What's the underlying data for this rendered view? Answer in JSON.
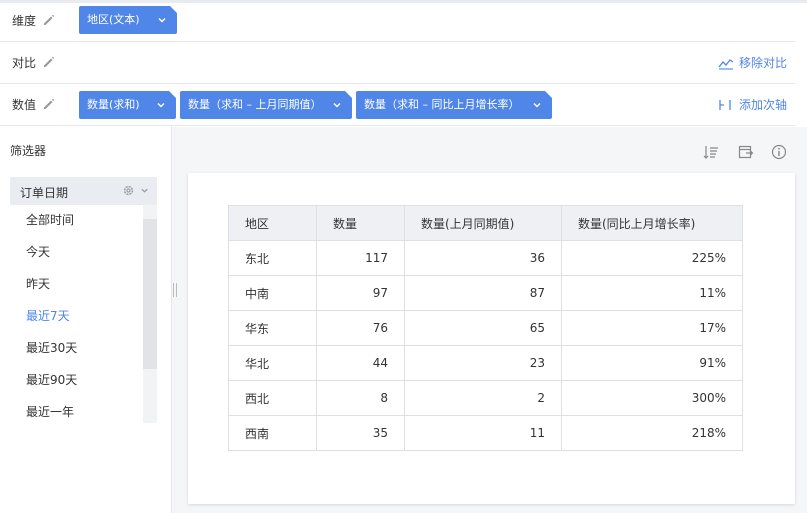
{
  "rows": {
    "dimension": {
      "label": "维度",
      "pills": [
        {
          "text": "地区(文本)"
        }
      ]
    },
    "compare": {
      "label": "对比",
      "action": "移除对比"
    },
    "value": {
      "label": "数值",
      "pills": [
        {
          "text": "数量(求和)"
        },
        {
          "text": "数量（求和 – 上月同期值）"
        },
        {
          "text": "数量（求和 – 同比上月增长率）"
        }
      ],
      "action": "添加次轴"
    }
  },
  "filter": {
    "title": "筛选器",
    "header": "订单日期",
    "options": [
      "全部时间",
      "今天",
      "昨天",
      "最近7天",
      "最近30天",
      "最近90天",
      "最近一年"
    ],
    "selected": "最近7天"
  },
  "colors": {
    "accent": "#4f86e8",
    "border": "#dcdfe5",
    "header_bg": "#eef0f4"
  },
  "toolbar_icons": [
    "sort-icon",
    "export-icon",
    "info-icon"
  ],
  "table": {
    "columns": [
      "地区",
      "数量",
      "数量(上月同期值)",
      "数量(同比上月增长率)"
    ],
    "rows": [
      [
        "东北",
        "117",
        "36",
        "225%"
      ],
      [
        "中南",
        "97",
        "87",
        "11%"
      ],
      [
        "华东",
        "76",
        "65",
        "17%"
      ],
      [
        "华北",
        "44",
        "23",
        "91%"
      ],
      [
        "西北",
        "8",
        "2",
        "300%"
      ],
      [
        "西南",
        "35",
        "11",
        "218%"
      ]
    ]
  }
}
